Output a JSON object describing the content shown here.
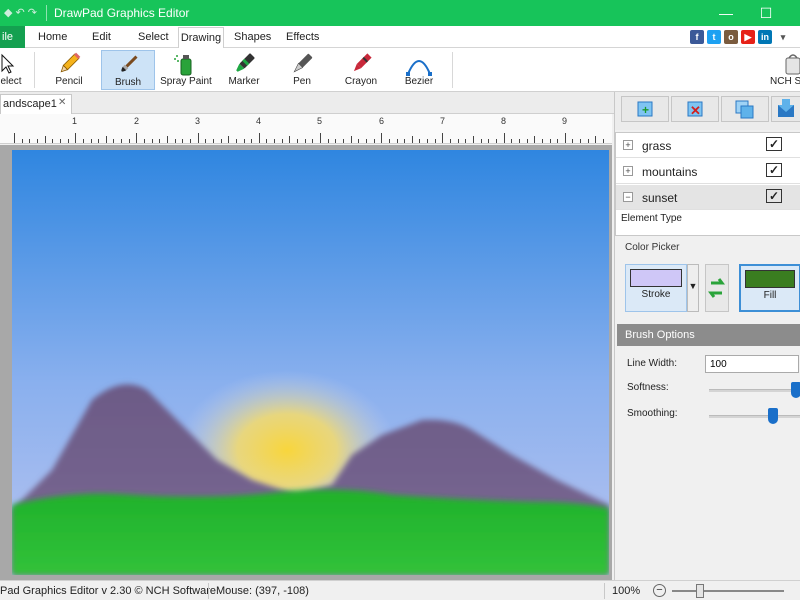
{
  "window": {
    "title": "DrawPad Graphics Editor",
    "qa_icons": [
      "app-icon",
      "undo-icon",
      "redo-icon"
    ],
    "controls": [
      "minimize",
      "maximize",
      "close"
    ]
  },
  "ribbon_tabs": [
    {
      "label": "ile",
      "key": "file"
    },
    {
      "label": "Home",
      "key": "home"
    },
    {
      "label": "Edit",
      "key": "edit"
    },
    {
      "label": "Select",
      "key": "select"
    },
    {
      "label": "Drawing",
      "key": "drawing",
      "active": true
    },
    {
      "label": "Shapes",
      "key": "shapes"
    },
    {
      "label": "Effects",
      "key": "effects"
    }
  ],
  "social_icons": [
    {
      "name": "facebook-icon",
      "glyph": "f",
      "color": "#3b5998"
    },
    {
      "name": "twitter-icon",
      "glyph": "t",
      "color": "#1da1f2"
    },
    {
      "name": "photo-icon",
      "glyph": "o",
      "color": "#7a5b3e"
    },
    {
      "name": "youtube-icon",
      "glyph": "▶",
      "color": "#e62117"
    },
    {
      "name": "linkedin-icon",
      "glyph": "in",
      "color": "#0077b5"
    },
    {
      "name": "help-dropdown-icon",
      "glyph": "▾",
      "color": "#555555"
    }
  ],
  "tools": [
    {
      "label": "elect",
      "icon": "select-cursor-icon"
    },
    {
      "label": "Pencil",
      "icon": "pencil-icon"
    },
    {
      "label": "Brush",
      "icon": "brush-icon",
      "active": true
    },
    {
      "label": "Spray Paint",
      "icon": "spray-paint-icon"
    },
    {
      "label": "Marker",
      "icon": "marker-icon"
    },
    {
      "label": "Pen",
      "icon": "pen-icon"
    },
    {
      "label": "Crayon",
      "icon": "crayon-icon"
    },
    {
      "label": "Bezier",
      "icon": "bezier-icon"
    },
    {
      "label": "NCH S",
      "icon": "nch-suite-icon"
    }
  ],
  "document": {
    "tab_label": "andscape1",
    "close_glyph": "✕"
  },
  "ruler": {
    "numbers": [
      "1",
      "2",
      "3",
      "4",
      "5",
      "6",
      "7",
      "8",
      "9"
    ]
  },
  "layers_panel": {
    "buttons": [
      "add-layer-icon",
      "delete-layer-icon",
      "duplicate-layer-icon",
      "layer-down-icon"
    ],
    "layers": [
      {
        "name": "grass",
        "expander": "+",
        "visible": true
      },
      {
        "name": "mountains",
        "expander": "+",
        "visible": true
      },
      {
        "name": "sunset",
        "expander": "−",
        "visible": true,
        "selected": true
      }
    ],
    "element_type_label": "Element Type"
  },
  "color_picker": {
    "label": "Color Picker",
    "stroke_label": "Stroke",
    "fill_label": "Fill",
    "stroke_color": "#cfc7f7",
    "fill_color": "#3a7d20",
    "swap_icon": "swap-colors-icon"
  },
  "brush_options": {
    "header": "Brush Options",
    "line_width_label": "Line Width:",
    "line_width_value": "100",
    "softness_label": "Softness:",
    "softness_level": 1.0,
    "smoothing_label": "Smoothing:",
    "smoothing_level": 0.7
  },
  "statusbar": {
    "app_text": "Pad Graphics Editor v 2.30 © NCH Software",
    "mouse_text": "Mouse: (397, -108)",
    "zoom_text": "100%",
    "zoom_out": "−",
    "zoom_in": "+",
    "zoom_level": 0.25
  },
  "colors": {
    "titlebar": "#17c45a",
    "file_tab": "#14a050",
    "sky_top": "#2f86e0",
    "sky_bottom": "#b8c4f0",
    "sun": "#f6d442",
    "mountains": "#6f5f88",
    "grass": "#1fb12a"
  }
}
